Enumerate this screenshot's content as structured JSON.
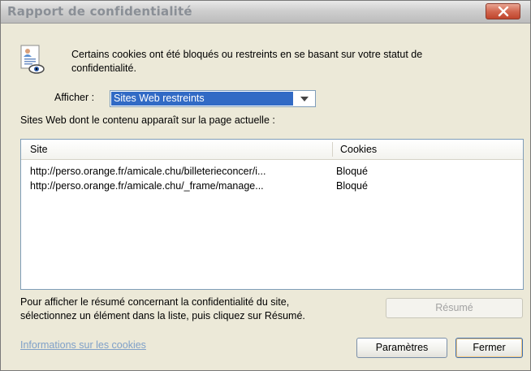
{
  "window": {
    "title": "Rapport de confidentialité"
  },
  "message": {
    "line1": "Certains cookies ont été bloqués ou restreints en se basant sur votre statut de",
    "line2": "confidentialité."
  },
  "filter": {
    "label": "Afficher :",
    "selected": "Sites Web restreints"
  },
  "sites_caption": "Sites Web dont le contenu apparaît sur la page actuelle :",
  "table": {
    "columns": [
      "Site",
      "Cookies"
    ],
    "rows": [
      {
        "site": "http://perso.orange.fr/amicale.chu/billeterieconcer/i...",
        "cookies": "Bloqué"
      },
      {
        "site": "http://perso.orange.fr/amicale.chu/_frame/manage...",
        "cookies": "Bloqué"
      }
    ]
  },
  "summary_hint": {
    "line1": "Pour afficher le résumé concernant la confidentialité du site,",
    "line2": "sélectionnez un élément dans la liste, puis cliquez sur Résumé."
  },
  "buttons": {
    "summary": "Résumé",
    "settings": "Paramètres",
    "close": "Fermer"
  },
  "link": "Informations sur les cookies",
  "icons": {
    "title_close": "close-icon",
    "info": "privacy-report-icon",
    "dropdown": "chevron-down-icon"
  },
  "colors": {
    "selection": "#316ac5",
    "close_button": "#c0452c",
    "link": "#7fa0c8"
  }
}
